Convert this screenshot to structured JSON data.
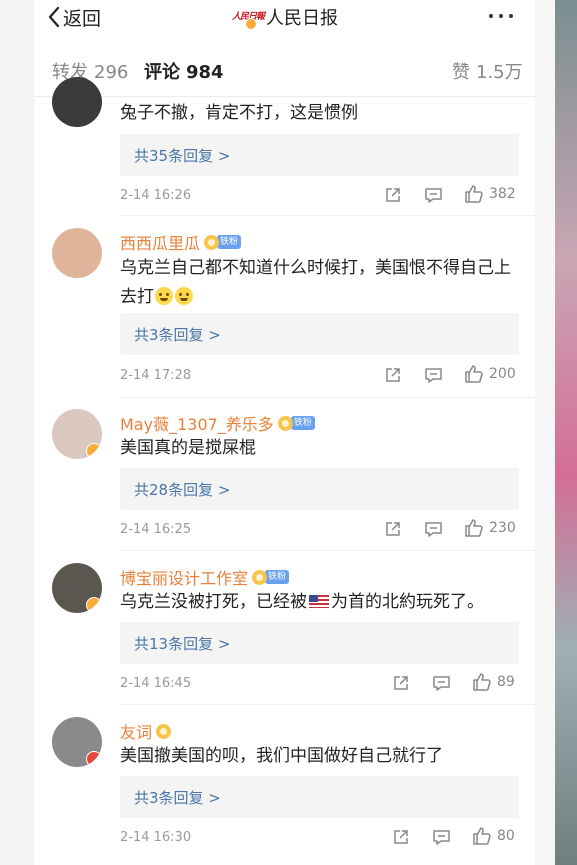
{
  "header": {
    "back_label": "返回",
    "account_name": "人民日报",
    "logo_text": "人民日報"
  },
  "tabs": {
    "repost_label": "转发",
    "repost_count": "296",
    "comments_label": "评论",
    "comments_count": "984",
    "likes_label": "赞",
    "likes_count": "1.5万"
  },
  "fan_badge_text": "铁粉",
  "comments": [
    {
      "username": "",
      "text": "兔子不撤，肯定不打，这是惯例",
      "replies_label": "共35条回复 >",
      "time": "2-14 16:26",
      "likes": "382",
      "avatar_color": "#3b3b3b"
    },
    {
      "username": "西西瓜里瓜",
      "text_part1": "乌克兰自己都不知道什么时候打，美国恨不得自己上去打",
      "replies_label": "共3条回复 >",
      "time": "2-14 17:28",
      "likes": "200",
      "avatar_color": "#e0b49a"
    },
    {
      "username": "May薇_1307_养乐多",
      "text": "美国真的是搅屎棍",
      "replies_label": "共28条回复 >",
      "time": "2-14 16:25",
      "likes": "230",
      "avatar_color": "#d9c7c0"
    },
    {
      "username": "博宝丽设计工作室",
      "text_part1": "乌克兰没被打死，已经被",
      "text_part2": "为首的北約玩死了。",
      "replies_label": "共13条回复 >",
      "time": "2-14 16:45",
      "likes": "89",
      "avatar_color": "#5b5650"
    },
    {
      "username": "友词",
      "text": "美国撤美国的呗，我们中国做好自己就行了",
      "replies_label": "共3条回复 >",
      "time": "2-14 16:30",
      "likes": "80",
      "avatar_color": "#8a8a8a"
    }
  ],
  "colors": {
    "username": "#e8823a",
    "reply_link": "#4a76a8",
    "meta": "#9a9a9a",
    "verified_orange": "#ffab3a",
    "verified_red": "#e8453c"
  }
}
